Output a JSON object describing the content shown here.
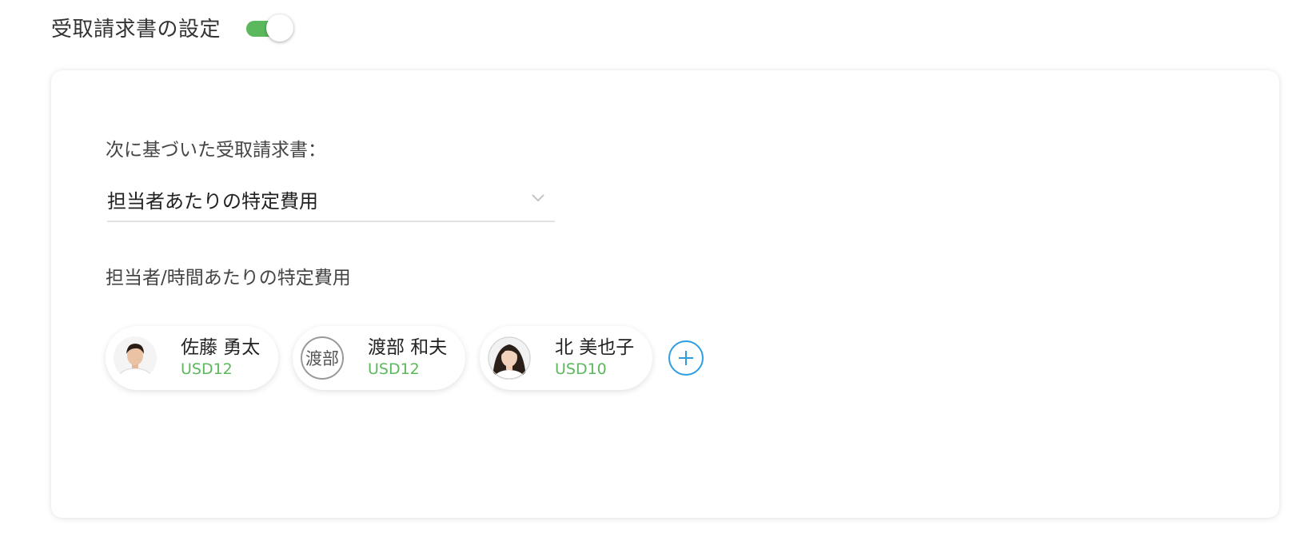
{
  "header": {
    "title": "受取請求書の設定",
    "toggle_on": true,
    "toggle_color": "#5cb85c"
  },
  "billing_basis": {
    "label": "次に基づいた受取請求書：",
    "selected": "担当者あたりの特定費用"
  },
  "staff_rates": {
    "label": "担当者/時間あたりの特定費用",
    "rate_color": "#5cb85c",
    "people": [
      {
        "name": "佐藤 勇太",
        "rate": "USD12",
        "avatar": "photo"
      },
      {
        "name": "渡部 和夫",
        "rate": "USD12",
        "avatar": "initials",
        "initials": "渡部"
      },
      {
        "name": "北 美也子",
        "rate": "USD10",
        "avatar": "photo"
      }
    ],
    "add_icon": "plus-circle-icon",
    "add_color": "#2d9ee0"
  }
}
